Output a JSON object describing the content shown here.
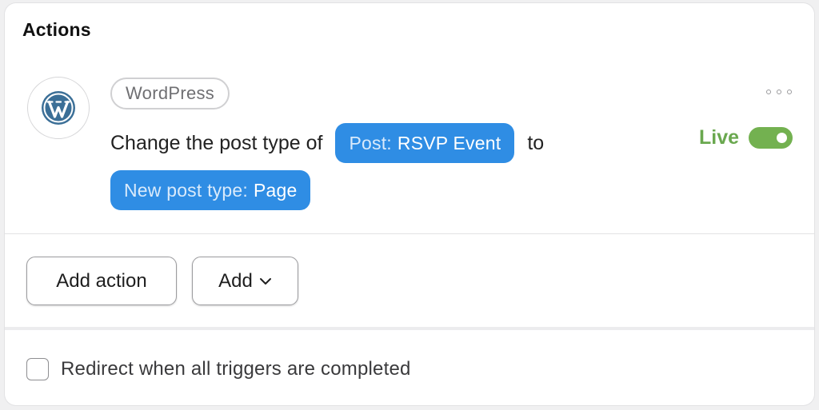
{
  "panel": {
    "title": "Actions"
  },
  "action": {
    "service_label": "WordPress",
    "logo_icon": "wordpress-logo",
    "sentence_prefix": "Change the post type of",
    "token_post": {
      "prefix": "Post:",
      "value": "RSVP Event"
    },
    "sentence_connector": "to",
    "token_new_type": {
      "prefix": "New post type:",
      "value": "Page"
    },
    "status_label": "Live",
    "status_enabled": true,
    "more_icon": "more-horizontal-icon"
  },
  "buttons": {
    "add_action": "Add action",
    "add": "Add",
    "add_chevron_icon": "chevron-down-icon"
  },
  "options": {
    "redirect_label": "Redirect when all triggers are completed",
    "redirect_checked": false
  },
  "colors": {
    "token_blue": "#2f8de4",
    "live_green": "#6aa84f",
    "toggle_green": "#73b150"
  }
}
